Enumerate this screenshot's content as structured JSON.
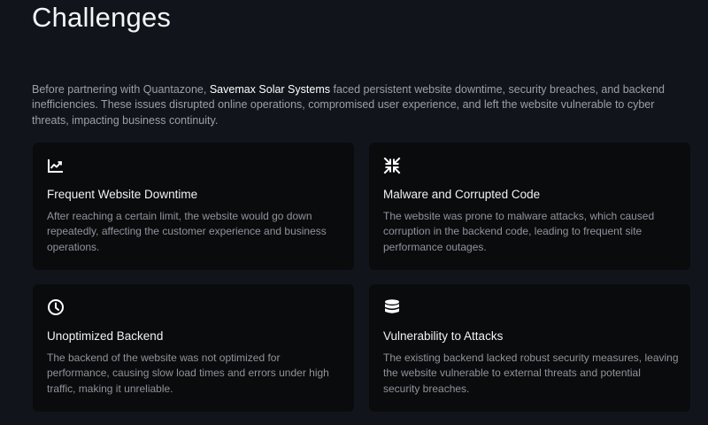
{
  "section": {
    "title": "Challenges",
    "intro_before": "Before partnering with Quantazone, ",
    "intro_highlight": "Savemax Solar Systems",
    "intro_after": " faced persistent website downtime, security breaches, and backend inefficiencies. These issues disrupted online operations, compromised user experience, and left the website vulnerable to cyber threats, impacting business continuity."
  },
  "cards": [
    {
      "icon": "trend-chart-icon",
      "title": "Frequent Website Downtime",
      "body": "After reaching a certain limit, the website would go down repeatedly, affecting the customer experience and business operations."
    },
    {
      "icon": "minimize-arrows-icon",
      "title": "Malware and Corrupted Code",
      "body": "The website was prone to malware attacks, which caused corruption in the backend code, leading to frequent site performance outages."
    },
    {
      "icon": "clock-icon",
      "title": "Unoptimized Backend",
      "body": "The backend of the website was not optimized for performance, causing slow load times and errors under high traffic, making it unreliable."
    },
    {
      "icon": "database-icon",
      "title": "Vulnerability to Attacks",
      "body": "The existing backend lacked robust security measures, leaving the website vulnerable to external threats and potential security breaches."
    }
  ],
  "colors": {
    "background": "#11151b",
    "card": "#0a0b0d",
    "title": "#f4f5f7",
    "muted": "#9aa0a8",
    "highlight": "#ffffff"
  }
}
